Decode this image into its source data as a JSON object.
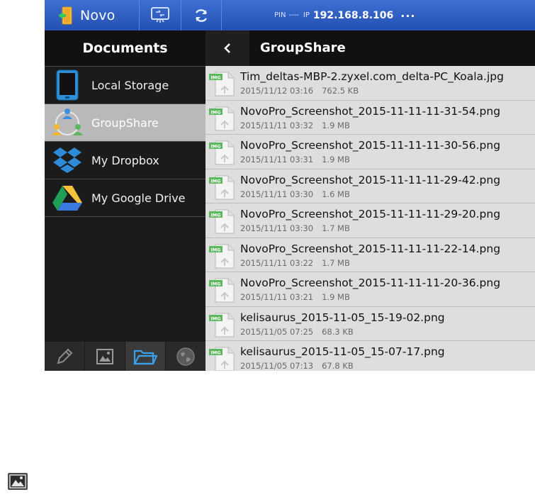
{
  "app": {
    "name": "Novo",
    "status": {
      "pin_label": "PIN",
      "pin_value": "----",
      "ip_label": "IP",
      "ip_value": "192.168.8.106",
      "more": "..."
    }
  },
  "left_panel": {
    "title": "Documents",
    "items": [
      {
        "label": "Local Storage",
        "icon": "tablet-icon"
      },
      {
        "label": "GroupShare",
        "icon": "groupshare-icon",
        "active": true
      },
      {
        "label": "My Dropbox",
        "icon": "dropbox-icon"
      },
      {
        "label": "My Google Drive",
        "icon": "google-drive-icon"
      }
    ],
    "bottom_tabs": [
      "pencil-icon",
      "image-icon",
      "folder-icon",
      "globe-icon"
    ],
    "active_bottom_tab": "folder-icon"
  },
  "right_panel": {
    "folder_title": "GroupShare",
    "file_icon_badge": "IMG",
    "files": [
      {
        "name": "Tim_deltas-MBP-2.zyxel.com_delta-PC_Koala.jpg",
        "date": "2015/11/12 03:16",
        "size": "762.5 KB"
      },
      {
        "name": "NovoPro_Screenshot_2015-11-11-11-31-54.png",
        "date": "2015/11/11 03:32",
        "size": "1.9 MB"
      },
      {
        "name": "NovoPro_Screenshot_2015-11-11-11-30-56.png",
        "date": "2015/11/11 03:31",
        "size": "1.9 MB"
      },
      {
        "name": "NovoPro_Screenshot_2015-11-11-11-29-42.png",
        "date": "2015/11/11 03:30",
        "size": "1.6 MB"
      },
      {
        "name": "NovoPro_Screenshot_2015-11-11-11-29-20.png",
        "date": "2015/11/11 03:30",
        "size": "1.7 MB"
      },
      {
        "name": "NovoPro_Screenshot_2015-11-11-11-22-14.png",
        "date": "2015/11/11 03:22",
        "size": "1.7 MB"
      },
      {
        "name": "NovoPro_Screenshot_2015-11-11-11-20-36.png",
        "date": "2015/11/11 03:21",
        "size": "1.9 MB"
      },
      {
        "name": "kelisaurus_2015-11-05_15-19-02.png",
        "date": "2015/11/05 07:25",
        "size": "68.3 KB"
      },
      {
        "name": "kelisaurus_2015-11-05_15-07-17.png",
        "date": "2015/11/05 07:13",
        "size": "67.8 KB"
      }
    ]
  },
  "colors": {
    "topbar": "#2f5fc6",
    "active_item": "#b9b9b9",
    "img_badge": "#5cb85c",
    "folder_tab": "#3aa0e8"
  }
}
